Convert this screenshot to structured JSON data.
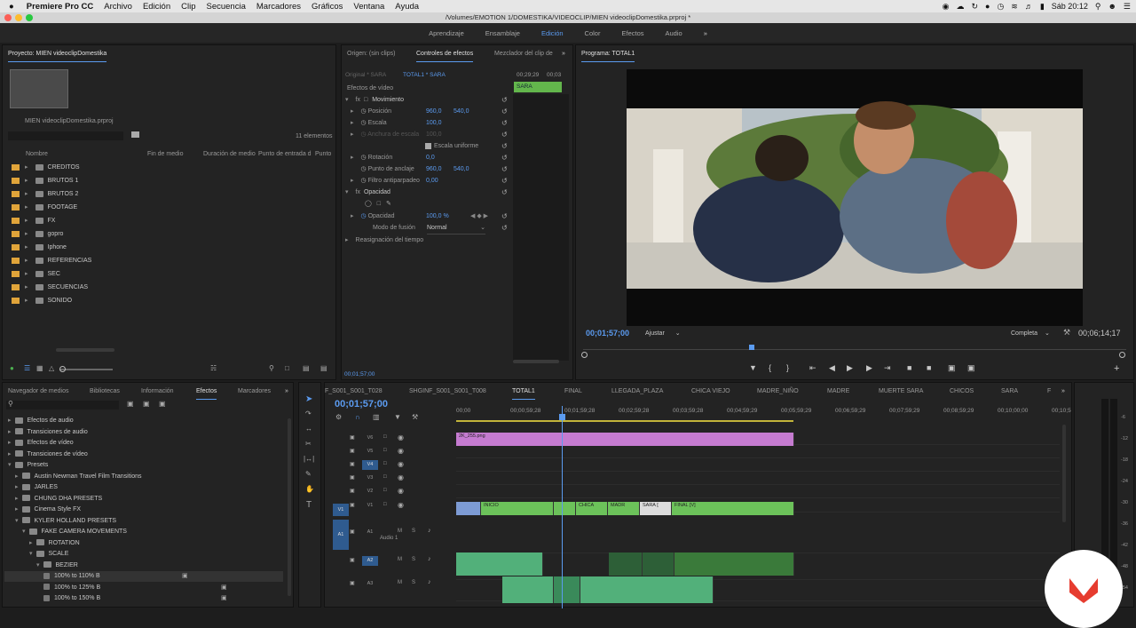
{
  "menubar": {
    "apple": "",
    "app": "Premiere Pro CC",
    "items": [
      "Archivo",
      "Edición",
      "Clip",
      "Secuencia",
      "Marcadores",
      "Gráficos",
      "Ventana",
      "Ayuda"
    ],
    "clock": "Sáb 20:12"
  },
  "titlebar": {
    "path": "/Volumes/EMOTION 1/DOMESTIKA/VIDEOCLIP/MIEN videoclipDomestika.prproj *"
  },
  "workspaces": [
    "Aprendizaje",
    "Ensamblaje",
    "Edición",
    "Color",
    "Efectos",
    "Audio"
  ],
  "project": {
    "tab": "Proyecto: MIEN videoclipDomestika",
    "file": "MIEN videoclipDomestika.prproj",
    "count": "11 elementos",
    "cols": [
      "Nombre",
      "Fin de medio",
      "Duración de medio",
      "Punto de entrada d",
      "Punto"
    ],
    "items": [
      "CREDITOS",
      "BRUTOS 1",
      "BRUTOS 2",
      "FOOTAGE",
      "FX",
      "gopro",
      "Iphone",
      "REFERENCIAS",
      "SEC",
      "SECUENCIAS",
      "SONIDO"
    ]
  },
  "effects_controls": {
    "tabs": [
      "Origen: (sin clips)",
      "Controles de efectos",
      "Mezclador del clip de"
    ],
    "master": "Original * SARA",
    "seq": "TOTAL1 * SARA",
    "tc1": "00;29;29",
    "tc2": "00;03",
    "clipname": "SARA",
    "video_effects": "Efectos de vídeo",
    "motion": "Movimiento",
    "position": "Posición",
    "pos_x": "960,0",
    "pos_y": "540,0",
    "scale": "Escala",
    "scale_v": "100,0",
    "scale_w": "Anchura de escala",
    "scale_w_v": "100,0",
    "uniform": "Escala uniforme",
    "rotation": "Rotación",
    "rotation_v": "0,0",
    "anchor": "Punto de anclaje",
    "anchor_x": "960,0",
    "anchor_y": "540,0",
    "flicker": "Filtro antiparpadeo",
    "flicker_v": "0,00",
    "opacity_grp": "Opacidad",
    "opacity": "Opacidad",
    "opacity_v": "100,0 %",
    "blend": "Modo de fusión",
    "blend_v": "Normal",
    "timeremap": "Reasignación del tiempo",
    "timecode": "00;01;57;00"
  },
  "program": {
    "tab": "Programa: TOTAL1",
    "tc": "00;01;57;00",
    "fit": "Ajustar",
    "quality": "Completa",
    "duration": "00;06;14;17"
  },
  "effects_panel": {
    "tabs": [
      "Navegador de medios",
      "Bibliotecas",
      "Información",
      "Efectos",
      "Marcadores"
    ],
    "items": [
      "Efectos de audio",
      "Transiciones de audio",
      "Efectos de vídeo",
      "Transiciones de vídeo",
      "Presets",
      "Austin Newman Travel Film Transitions",
      "JARLES",
      "CHUNG DHA PRESETS",
      "Cinema Style FX",
      "KYLER HOLLAND PRESETS",
      "FAKE CAMERA MOVEMENTS",
      "ROTATION",
      "SCALE",
      "BEZIER",
      "100% to 110% B",
      "100% to 125% B",
      "100% to 150% B"
    ]
  },
  "timeline": {
    "tabs": [
      "F_S001_S001_T028",
      "SHGINF_S001_S001_T008",
      "TOTAL1",
      "FINAL",
      "LLEGADA_PLAZA",
      "CHICA VIEJO",
      "MADRE_NIÑO",
      "MADRE",
      "MUERTE SARA",
      "CHICOS",
      "SARA",
      "F"
    ],
    "tc": "00;01;57;00",
    "ruler": [
      "00;00",
      "00;00;59;28",
      "00;01;59;28",
      "00;02;59;28",
      "00;03;59;28",
      "00;04;59;29",
      "00;05;59;29",
      "00;06;59;29",
      "00;07;59;29",
      "00;08;59;29",
      "00;10;00;00",
      "00;10;5"
    ],
    "tracks": [
      "V6",
      "V5",
      "V4",
      "V3",
      "V2",
      "V1",
      "A1",
      "A2",
      "A3"
    ],
    "audio1": "Audio 1",
    "clips": {
      "png": "2K_255.png",
      "inicio": "INICIO",
      "chica": "CHICA",
      "madre": "MADR",
      "sara": "SARA [",
      "final": "FINAL [V]"
    }
  },
  "meter": [
    "-6",
    "-12",
    "-18",
    "-24",
    "-30",
    "-36",
    "-42",
    "-48",
    "-54"
  ]
}
